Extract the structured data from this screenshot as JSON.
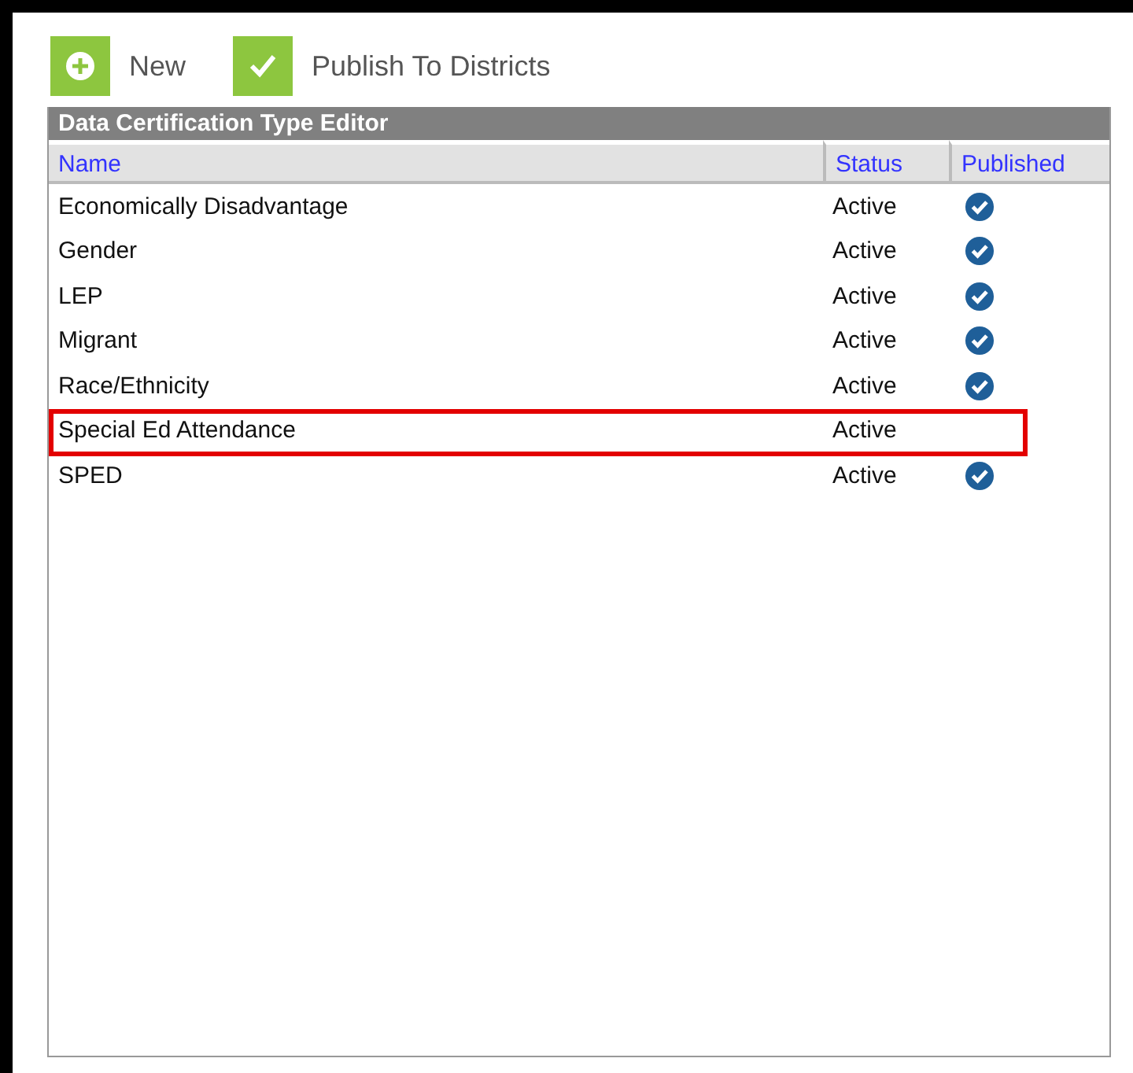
{
  "toolbar": [
    {
      "kind": "new",
      "label": "New"
    },
    {
      "kind": "publish",
      "label": "Publish To Districts"
    }
  ],
  "panel": {
    "title": "Data Certification Type Editor",
    "columns": [
      "Name",
      "Status",
      "Published"
    ],
    "rows": [
      {
        "name": "Economically Disadvantage",
        "status": "Active",
        "published": true,
        "highlighted": false
      },
      {
        "name": "Gender",
        "status": "Active",
        "published": true,
        "highlighted": false
      },
      {
        "name": "LEP",
        "status": "Active",
        "published": true,
        "highlighted": false
      },
      {
        "name": "Migrant",
        "status": "Active",
        "published": true,
        "highlighted": false
      },
      {
        "name": "Race/Ethnicity",
        "status": "Active",
        "published": true,
        "highlighted": false
      },
      {
        "name": "Special Ed Attendance",
        "status": "Active",
        "published": false,
        "highlighted": true
      },
      {
        "name": "SPED",
        "status": "Active",
        "published": true,
        "highlighted": false
      }
    ]
  }
}
